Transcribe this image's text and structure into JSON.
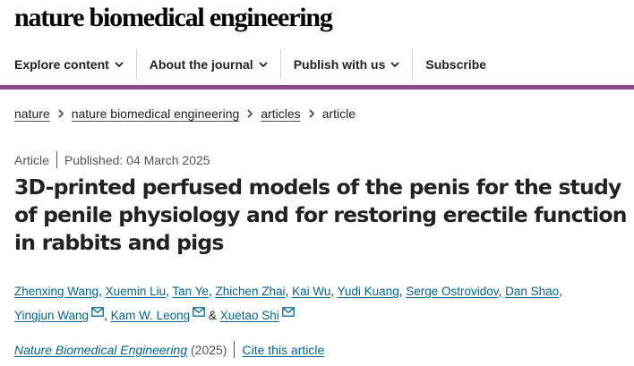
{
  "header": {
    "brand": "nature biomedical engineering"
  },
  "nav": {
    "items": [
      {
        "label": "Explore content"
      },
      {
        "label": "About the journal"
      },
      {
        "label": "Publish with us"
      }
    ],
    "subscribe": "Subscribe"
  },
  "breadcrumb": {
    "items": [
      "nature",
      "nature biomedical engineering",
      "articles"
    ],
    "current": "article"
  },
  "article": {
    "type": "Article",
    "published": "Published: 04 March 2025",
    "title": "3D-printed perfused models of the penis for the study of penile physiology and for restoring erectile function in rabbits and pigs",
    "authors": [
      "Zhenxing Wang",
      "Xuemin Liu",
      "Tan Ye",
      "Zhichen Zhai",
      "Kai Wu",
      "Yudi Kuang",
      "Serge Ostrovidov",
      "Dan Shao",
      "Yingjun Wang",
      "Kam W. Leong",
      "Xuetao Shi"
    ],
    "author_separator": ",",
    "author_last_joiner": "&",
    "journal": "Nature Biomedical Engineering",
    "year": "(2025)",
    "cite_label": "Cite this article"
  },
  "colors": {
    "accent_bar": "#8c4a8c",
    "link": "#006699",
    "text": "#222222"
  },
  "icons": {
    "nav_dropdown": "chevron-down-icon",
    "breadcrumb_separator": "chevron-right-icon",
    "corresponding_author": "mail-icon"
  }
}
